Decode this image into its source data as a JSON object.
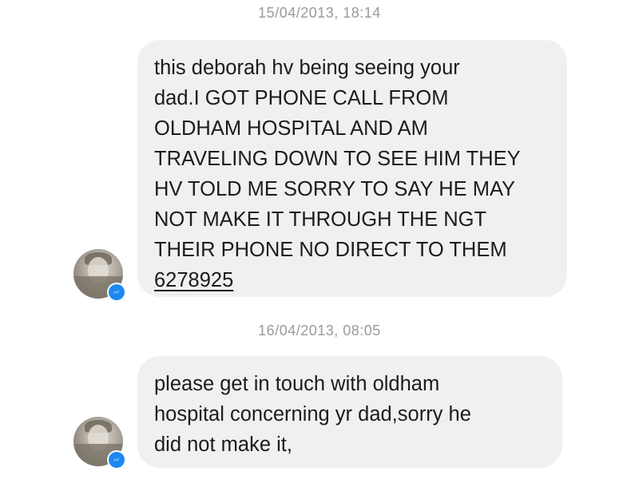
{
  "conversation": {
    "messages": [
      {
        "timestamp": "15/04/2013, 18:14",
        "lines": [
          "this deborah hv being seeing your",
          "dad.I GOT PHONE CALL FROM",
          "OLDHAM HOSPITAL AND AM",
          "TRAVELING DOWN TO SEE HIM THEY",
          "HV TOLD ME SORRY TO SAY HE MAY",
          "NOT MAKE IT THROUGH THE NGT",
          "THEIR PHONE NO DIRECT TO THEM"
        ],
        "phone_link": "6278925"
      },
      {
        "timestamp": "16/04/2013, 08:05",
        "lines": [
          "please get in touch with oldham",
          "hospital concerning yr dad,sorry he",
          "did not make it,"
        ]
      }
    ],
    "avatar_badge_icon": "messenger-icon",
    "colors": {
      "bubble": "#f1f0f0",
      "timestamp": "#9a9a9e",
      "badge": "#1e88f0"
    }
  }
}
